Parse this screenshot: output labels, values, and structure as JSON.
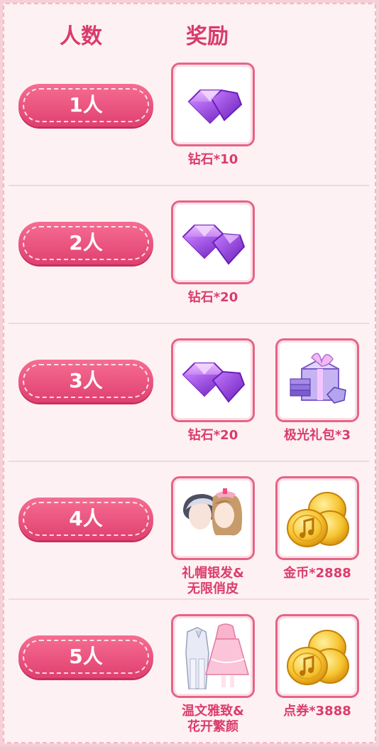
{
  "header": {
    "count_label": "人数",
    "reward_label": "奖励"
  },
  "rows": [
    {
      "count": "1人",
      "rewards": [
        {
          "label": "钻石*10",
          "icon": "diamond-icon"
        }
      ]
    },
    {
      "count": "2人",
      "rewards": [
        {
          "label": "钻石*20",
          "icon": "diamond-icon"
        }
      ]
    },
    {
      "count": "3人",
      "rewards": [
        {
          "label": "钻石*20",
          "icon": "diamond-icon"
        },
        {
          "label": "极光礼包*3",
          "icon": "gift-box-icon"
        }
      ]
    },
    {
      "count": "4人",
      "rewards": [
        {
          "label_line1": "礼帽银发&",
          "label_line2": "无限俏皮",
          "icon": "hair-avatar-icon"
        },
        {
          "label": "金币*2888",
          "icon": "gold-coin-icon"
        }
      ]
    },
    {
      "count": "5人",
      "rewards": [
        {
          "label_line1": "温文雅致&",
          "label_line2": "花开繁颜",
          "icon": "outfit-icon"
        },
        {
          "label": "点券*3888",
          "icon": "coupon-coin-icon"
        }
      ]
    }
  ],
  "colors": {
    "accent": "#d93b6b",
    "pill": "#e94a77",
    "background": "#fdf1f4"
  }
}
